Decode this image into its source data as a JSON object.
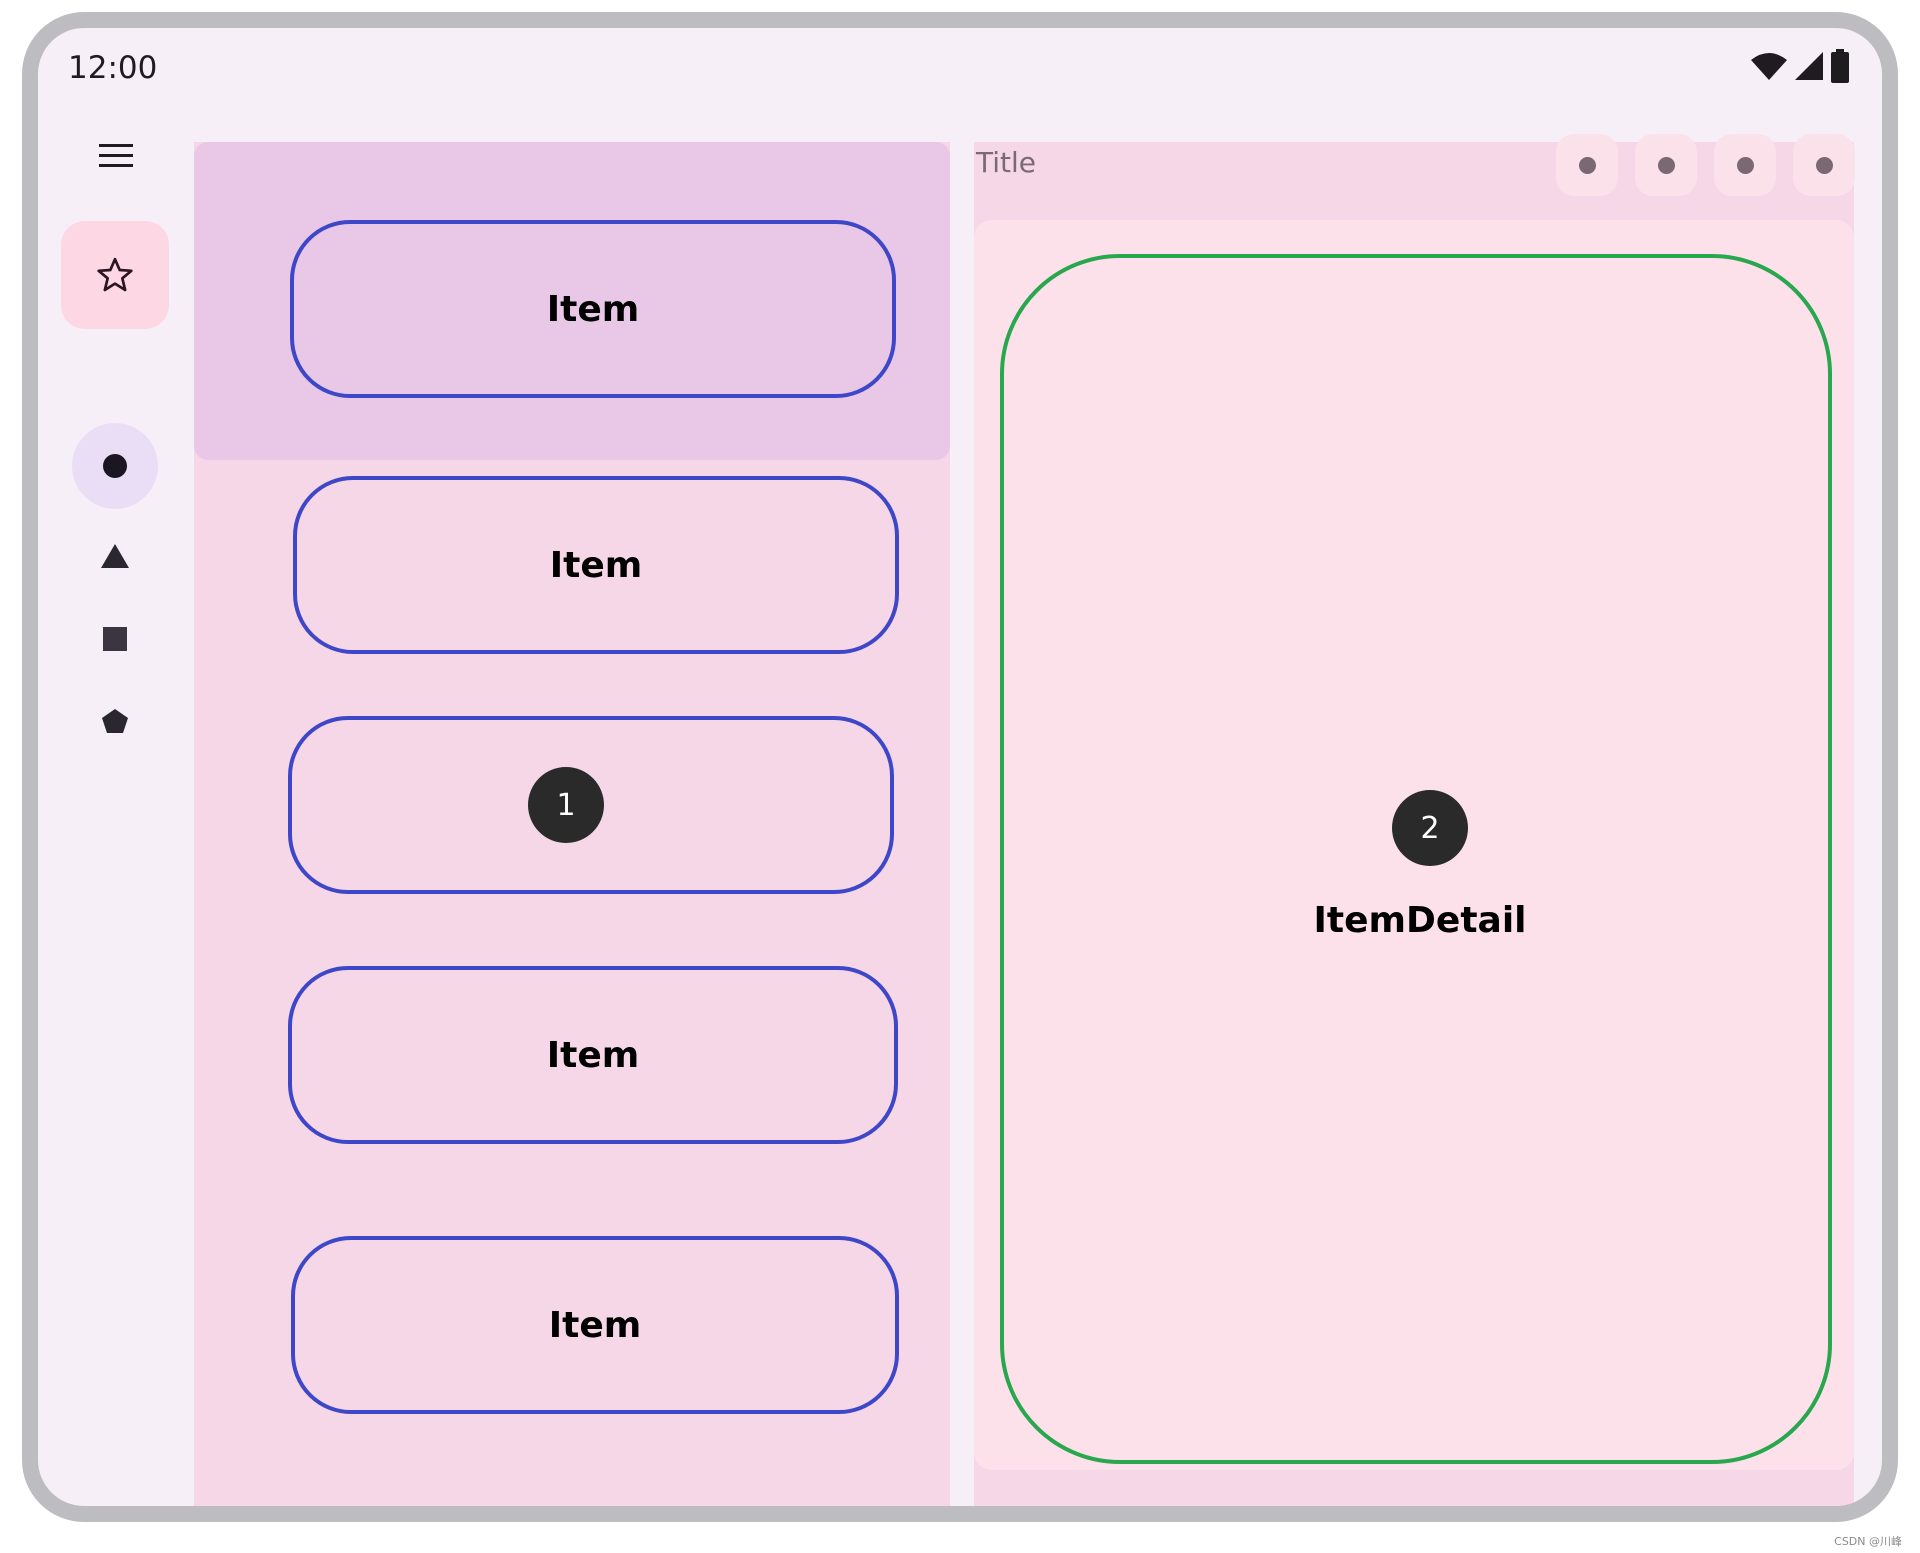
{
  "status_bar": {
    "time": "12:00",
    "icons": [
      "wifi-icon",
      "signal-icon",
      "battery-icon"
    ]
  },
  "navigation_rail": {
    "menu_icon": "menu-icon",
    "fab_icon": "star-icon",
    "items": [
      {
        "icon": "circle-icon",
        "selected": true
      },
      {
        "icon": "triangle-icon",
        "selected": false
      },
      {
        "icon": "square-icon",
        "selected": false
      },
      {
        "icon": "pentagon-icon",
        "selected": false
      }
    ]
  },
  "list_pane": {
    "items": [
      {
        "label": "Item"
      },
      {
        "label": "Item"
      },
      {
        "badge": "1"
      },
      {
        "label": "Item"
      },
      {
        "label": "Item"
      }
    ]
  },
  "detail_pane": {
    "title": "Title",
    "action_count_icons": [
      "action-dot-icon",
      "action-dot-icon",
      "action-dot-icon",
      "action-dot-icon"
    ],
    "badge": "2",
    "label": "ItemDetail"
  },
  "watermark": "CSDN @川峰",
  "colors": {
    "frame": "#bdbcc0",
    "surface": "#f6eff7",
    "list_header": "#e8c8e6",
    "pane": "#f6d7e7",
    "detail_card": "#fde1ea",
    "item_outline": "#3e47c8",
    "detail_outline": "#28a74f",
    "fab": "#fdd7e3",
    "rail_selected": "#e9def5"
  }
}
